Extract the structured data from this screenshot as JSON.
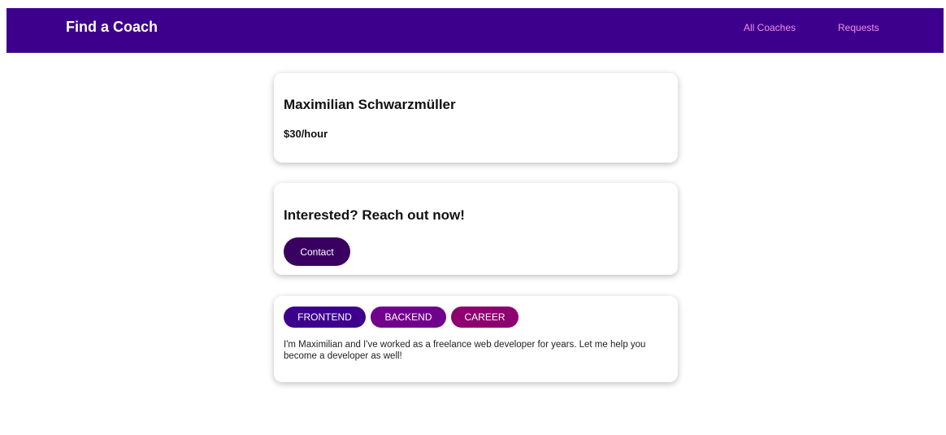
{
  "header": {
    "title": "Find a Coach",
    "nav": [
      {
        "label": "All Coaches"
      },
      {
        "label": "Requests"
      }
    ],
    "background_color": "#3d008d",
    "link_color": "#f391e3"
  },
  "coach": {
    "name": "Maximilian Schwarzmüller",
    "rate": "$30/hour"
  },
  "contact": {
    "heading": "Interested? Reach out now!",
    "button_label": "Contact",
    "button_color": "#3a0061"
  },
  "details": {
    "areas": [
      {
        "label": "FRONTEND",
        "color": "#3d008d"
      },
      {
        "label": "BACKEND",
        "color": "#71008d"
      },
      {
        "label": "CAREER",
        "color": "#8d006e"
      }
    ],
    "description": "I'm Maximilian and I've worked as a freelance web developer for years. Let me help you become a developer as well!"
  }
}
